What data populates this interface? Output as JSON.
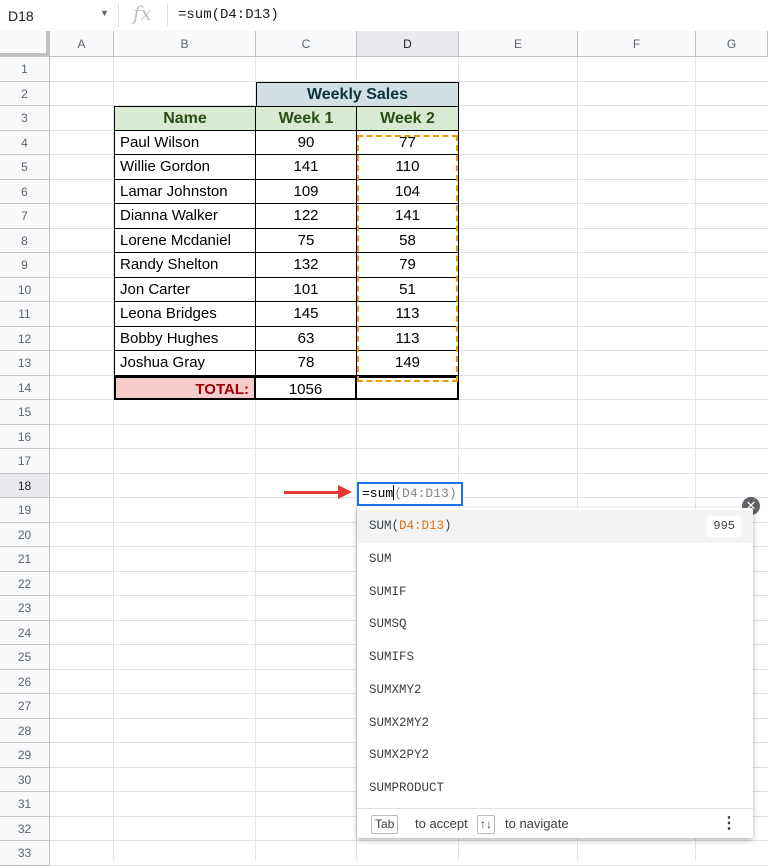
{
  "formula_bar": {
    "cell_ref": "D18",
    "fx": "fx",
    "formula": "=sum(D4:D13)"
  },
  "columns": [
    "A",
    "B",
    "C",
    "D",
    "E",
    "F",
    "G"
  ],
  "rows": [
    "1",
    "2",
    "3",
    "4",
    "5",
    "6",
    "7",
    "8",
    "9",
    "10",
    "11",
    "12",
    "13",
    "14",
    "15",
    "16",
    "17",
    "18",
    "19",
    "20",
    "21",
    "22",
    "23",
    "24",
    "25",
    "26",
    "27",
    "28",
    "29",
    "30",
    "31",
    "32",
    "33"
  ],
  "table": {
    "title": "Weekly Sales",
    "headers": [
      "Name",
      "Week 1",
      "Week 2"
    ],
    "rows": [
      [
        "Paul Wilson",
        "90",
        "77"
      ],
      [
        "Willie Gordon",
        "141",
        "110"
      ],
      [
        "Lamar Johnston",
        "109",
        "104"
      ],
      [
        "Dianna Walker",
        "122",
        "141"
      ],
      [
        "Lorene Mcdaniel",
        "75",
        "58"
      ],
      [
        "Randy Shelton",
        "132",
        "79"
      ],
      [
        "Jon Carter",
        "101",
        "51"
      ],
      [
        "Leona Bridges",
        "145",
        "113"
      ],
      [
        "Bobby Hughes",
        "63",
        "113"
      ],
      [
        "Joshua Gray",
        "78",
        "149"
      ]
    ],
    "total_label": "TOTAL:",
    "total_week1": "1056",
    "total_week2": ""
  },
  "editor": {
    "typed": "=sum",
    "hint": "(D4:D13)"
  },
  "autocomplete": {
    "top": {
      "fn": "SUM(",
      "range": "D4:D13",
      "close": ")",
      "result": "995"
    },
    "items": [
      "SUM",
      "SUMIF",
      "SUMSQ",
      "SUMIFS",
      "SUMXMY2",
      "SUMX2MY2",
      "SUMX2PY2",
      "SUMPRODUCT"
    ],
    "footer": {
      "tab": "Tab",
      "accept": "to accept",
      "keys": "↑↓",
      "navigate": "to navigate",
      "more": "⋮"
    }
  },
  "colors": {
    "accent": "#1a73e8",
    "range_highlight": "#f29900",
    "arrow": "#e53935"
  }
}
